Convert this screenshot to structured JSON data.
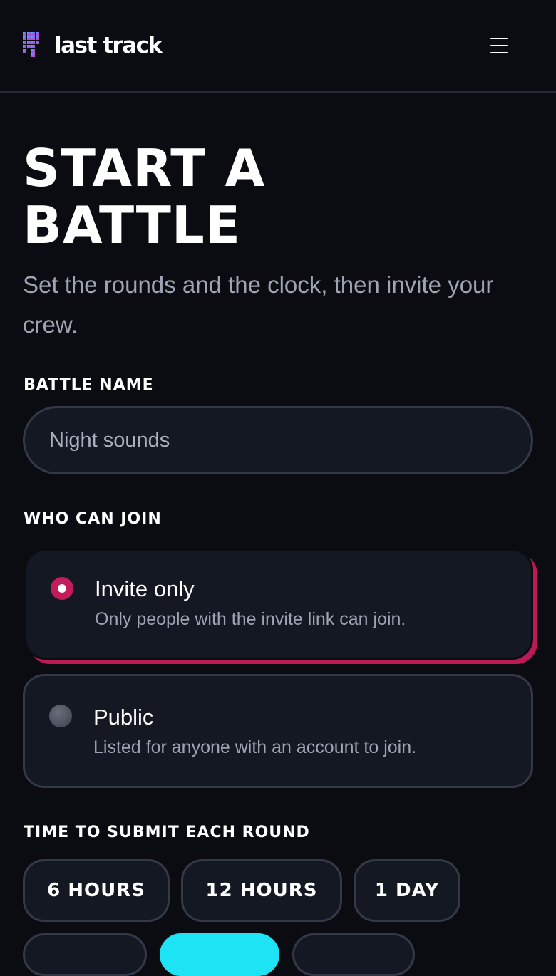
{
  "header": {
    "logo_text": "last track",
    "menu_icon": "hamburger-menu-icon"
  },
  "page": {
    "title_line1": "START A",
    "title_line2": "BATTLE",
    "subtitle": "Set the rounds and the clock, then invite your crew."
  },
  "battle_name": {
    "label": "BATTLE NAME",
    "value": "Night sounds"
  },
  "who_can_join": {
    "label": "WHO CAN JOIN",
    "options": [
      {
        "title": "Invite only",
        "description": "Only people with the invite link can join.",
        "selected": true
      },
      {
        "title": "Public",
        "description": "Listed for anyone with an account to join.",
        "selected": false
      }
    ]
  },
  "submit_time": {
    "label": "TIME TO SUBMIT EACH ROUND",
    "chips": [
      "6 HOURS",
      "12 HOURS",
      "1 DAY"
    ]
  },
  "colors": {
    "background": "#0b0c12",
    "surface": "#141822",
    "border": "#343948",
    "accent_pink": "#c21d5a",
    "accent_cyan": "#1ee3f5"
  }
}
